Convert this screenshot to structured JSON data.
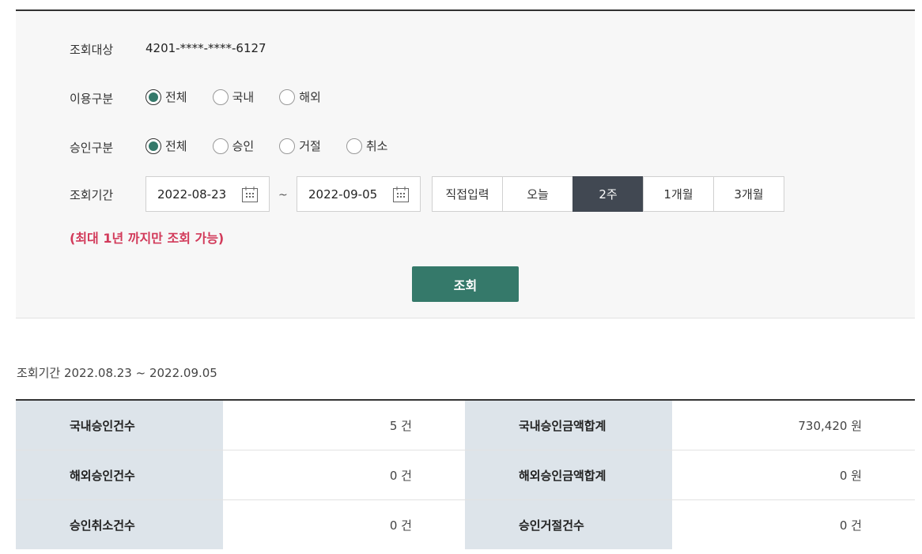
{
  "search": {
    "target_label": "조회대상",
    "target_value": "4201-****-****-6127",
    "usage_label": "이용구분",
    "usage_options": [
      "전체",
      "국내",
      "해외"
    ],
    "usage_selected": "전체",
    "approval_label": "승인구분",
    "approval_options": [
      "전체",
      "승인",
      "거절",
      "취소"
    ],
    "approval_selected": "전체",
    "period_label": "조회기간",
    "start_date": "2022-08-23",
    "end_date": "2022-09-05",
    "range_separator": "~",
    "period_buttons": [
      "직접입력",
      "오늘",
      "2주",
      "1개월",
      "3개월"
    ],
    "period_active": "2주",
    "notice": "(최대 1년 까지만 조회 가능)",
    "search_button": "조회"
  },
  "results": {
    "period_summary": "조회기간 2022.08.23 ~ 2022.09.05",
    "rows": [
      {
        "label1": "국내승인건수",
        "value1": "5 건",
        "label2": "국내승인금액합계",
        "value2": "730,420 원"
      },
      {
        "label1": "해외승인건수",
        "value1": "0 건",
        "label2": "해외승인금액합계",
        "value2": "0 원"
      },
      {
        "label1": "승인취소건수",
        "value1": "0 건",
        "label2": "승인거절건수",
        "value2": "0 건"
      }
    ]
  },
  "colors": {
    "accent": "#35796a",
    "active_period": "#414852",
    "notice": "#d23a5a",
    "table_header": "#dde4ea"
  },
  "icons": {
    "calendar": "calendar-icon",
    "radio": "radio-button"
  }
}
